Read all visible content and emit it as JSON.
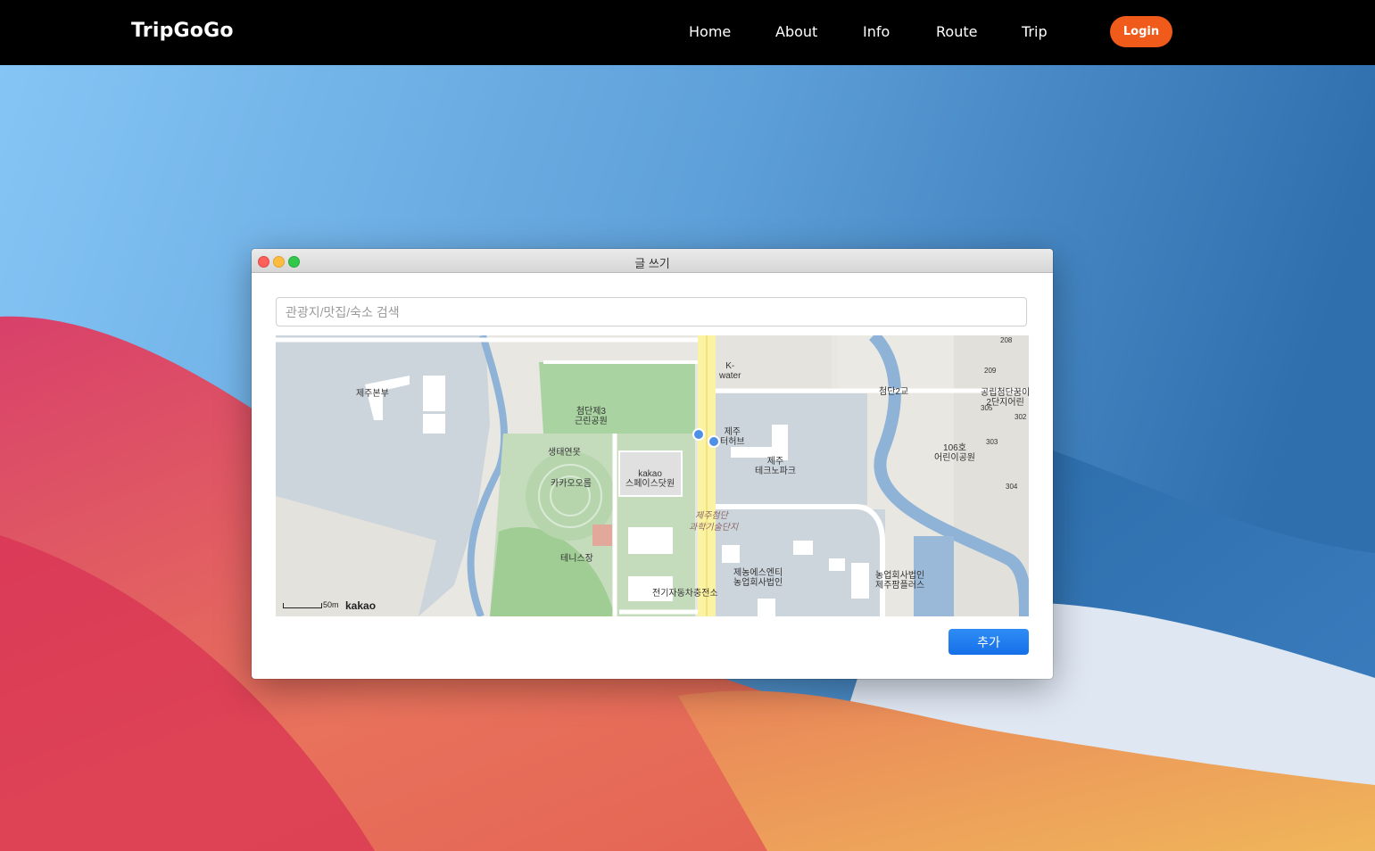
{
  "nav": {
    "brand": "TripGoGo",
    "links": [
      "Home",
      "About",
      "Info",
      "Route",
      "Trip"
    ],
    "login_label": "Login"
  },
  "window": {
    "title": "글 쓰기",
    "search": {
      "placeholder": "관광지/맛집/숙소 검색",
      "value": ""
    },
    "add_label": "추가"
  },
  "map": {
    "labels": [
      "제주본부",
      "첨단제3\n근린공원",
      "생태연못",
      "카카오오름",
      "kakao\n스페이스닷원",
      "테니스장",
      "전기자동차충전소",
      "제주\n터허브",
      "제주\n테크노파크",
      "제주첨단",
      "과학기술단지",
      "제농에스엔티\n농업회사법인",
      "농업회사법인\n제주팜플러스",
      "K-\nwater",
      "첨단2교",
      "공립첨단꿈이\n2단지어린",
      "106호\n어린이공원",
      "208",
      "209",
      "302",
      "303",
      "304",
      "305"
    ],
    "scale_label": "50m",
    "provider": "kakao"
  },
  "colors": {
    "login": "#f05a1a",
    "add_button": "#1f7ef0",
    "map_park": "#a9d3a0",
    "map_water": "#8fb3d6",
    "map_road_main": "#fbf3a4"
  }
}
